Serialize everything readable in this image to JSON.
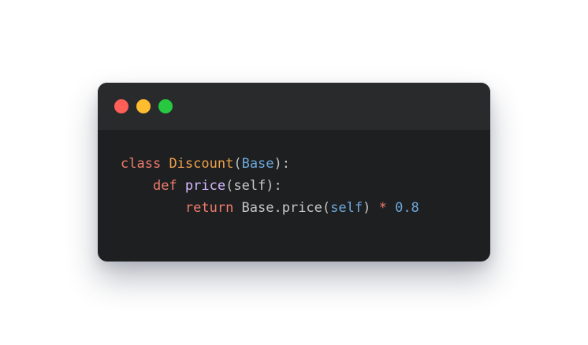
{
  "window": {
    "controls": [
      {
        "name": "close",
        "color": "#ff5f57"
      },
      {
        "name": "minimize",
        "color": "#febc2e"
      },
      {
        "name": "maximize",
        "color": "#28c840"
      }
    ]
  },
  "code": {
    "lines": [
      {
        "indent": "",
        "tokens": [
          {
            "text": "class",
            "color": "#f07c6c"
          },
          {
            "text": " ",
            "color": "#c5c8c6"
          },
          {
            "text": "Discount",
            "color": "#f0a04b"
          },
          {
            "text": "(",
            "color": "#c5c8c6"
          },
          {
            "text": "Base",
            "color": "#6fa8dc"
          },
          {
            "text": "):",
            "color": "#c5c8c6"
          }
        ]
      },
      {
        "indent": "    ",
        "tokens": [
          {
            "text": "def",
            "color": "#f07c6c"
          },
          {
            "text": " ",
            "color": "#c5c8c6"
          },
          {
            "text": "price",
            "color": "#d7b8ff"
          },
          {
            "text": "(self):",
            "color": "#c5c8c6"
          }
        ]
      },
      {
        "indent": "        ",
        "tokens": [
          {
            "text": "return",
            "color": "#f07c6c"
          },
          {
            "text": " Base.price(",
            "color": "#c5c8c6"
          },
          {
            "text": "self",
            "color": "#6fa8dc"
          },
          {
            "text": ") ",
            "color": "#c5c8c6"
          },
          {
            "text": "*",
            "color": "#f07c6c"
          },
          {
            "text": " ",
            "color": "#c5c8c6"
          },
          {
            "text": "0.8",
            "color": "#6fa8dc"
          }
        ]
      }
    ]
  }
}
